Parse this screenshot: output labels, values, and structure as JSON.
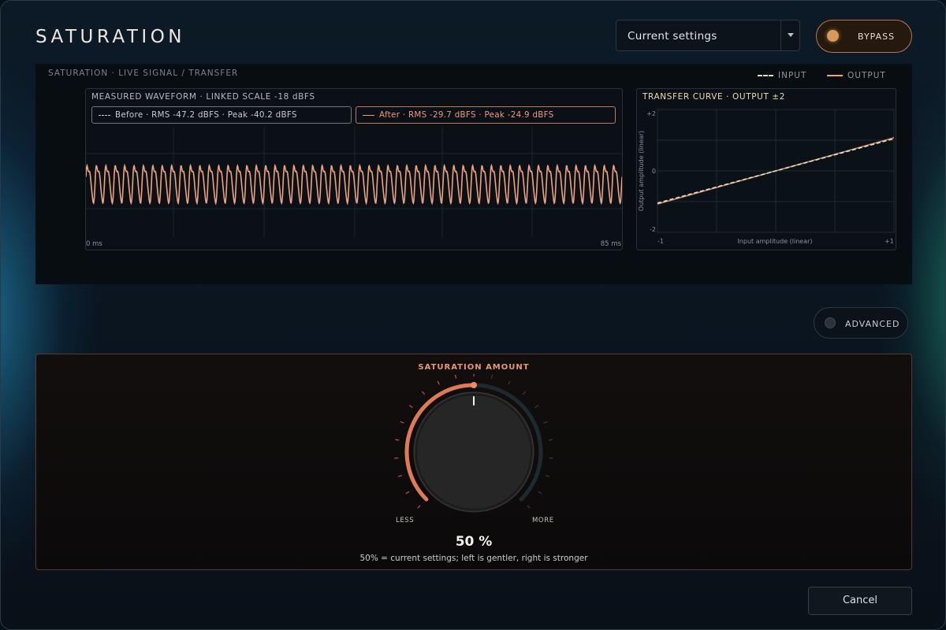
{
  "header": {
    "title": "SATURATION",
    "preset_value": "Current settings",
    "bypass_label": "BYPASS"
  },
  "monitor": {
    "title": "SATURATION · LIVE SIGNAL / TRANSFER",
    "legend_input": "INPUT",
    "legend_output": "OUTPUT",
    "colors": {
      "input": "#e6e0c8",
      "output": "#f0a27c"
    }
  },
  "waveform": {
    "title": "MEASURED WAVEFORM · LINKED SCALE -18 dBFS",
    "before_chip": "Before · RMS -47.2 dBFS · Peak -40.2 dBFS",
    "after_chip": "After · RMS -29.7 dBFS · Peak -24.9 dBFS",
    "x_start": "0 ms",
    "x_end": "85 ms"
  },
  "transfer": {
    "title": "TRANSFER CURVE · OUTPUT ±2",
    "y_top": "+2",
    "y_mid": "0",
    "y_bottom": "-2",
    "x_left": "-1",
    "x_right": "+1",
    "xlabel": "Input amplitude (linear)",
    "ylabel": "Output amplitude (linear)"
  },
  "advanced_label": "ADVANCED",
  "amount": {
    "title": "SATURATION AMOUNT",
    "less": "LESS",
    "more": "MORE",
    "value_text": "50 %",
    "value_fraction": 0.5,
    "hint": "50% = current settings; left is gentler, right is stronger"
  },
  "cancel_label": "Cancel",
  "chart_data": [
    {
      "type": "line",
      "title": "MEASURED WAVEFORM · LINKED SCALE -18 dBFS",
      "x_range_ms": [
        0,
        85
      ],
      "series": [
        {
          "name": "After",
          "rms_dbfs": -29.7,
          "peak_dbfs": -24.9
        },
        {
          "name": "Before",
          "rms_dbfs": -47.2,
          "peak_dbfs": -40.2
        }
      ]
    },
    {
      "type": "line",
      "title": "TRANSFER CURVE · OUTPUT ±2",
      "xlabel": "Input amplitude (linear)",
      "ylabel": "Output amplitude (linear)",
      "xlim": [
        -1,
        1
      ],
      "ylim": [
        -2,
        2
      ],
      "series": [
        {
          "name": "INPUT",
          "x": [
            -1,
            0,
            1
          ],
          "y": [
            -1.05,
            0,
            1.05
          ]
        },
        {
          "name": "OUTPUT",
          "x": [
            -1,
            0,
            1
          ],
          "y": [
            -1.08,
            0,
            1.08
          ]
        }
      ]
    }
  ]
}
